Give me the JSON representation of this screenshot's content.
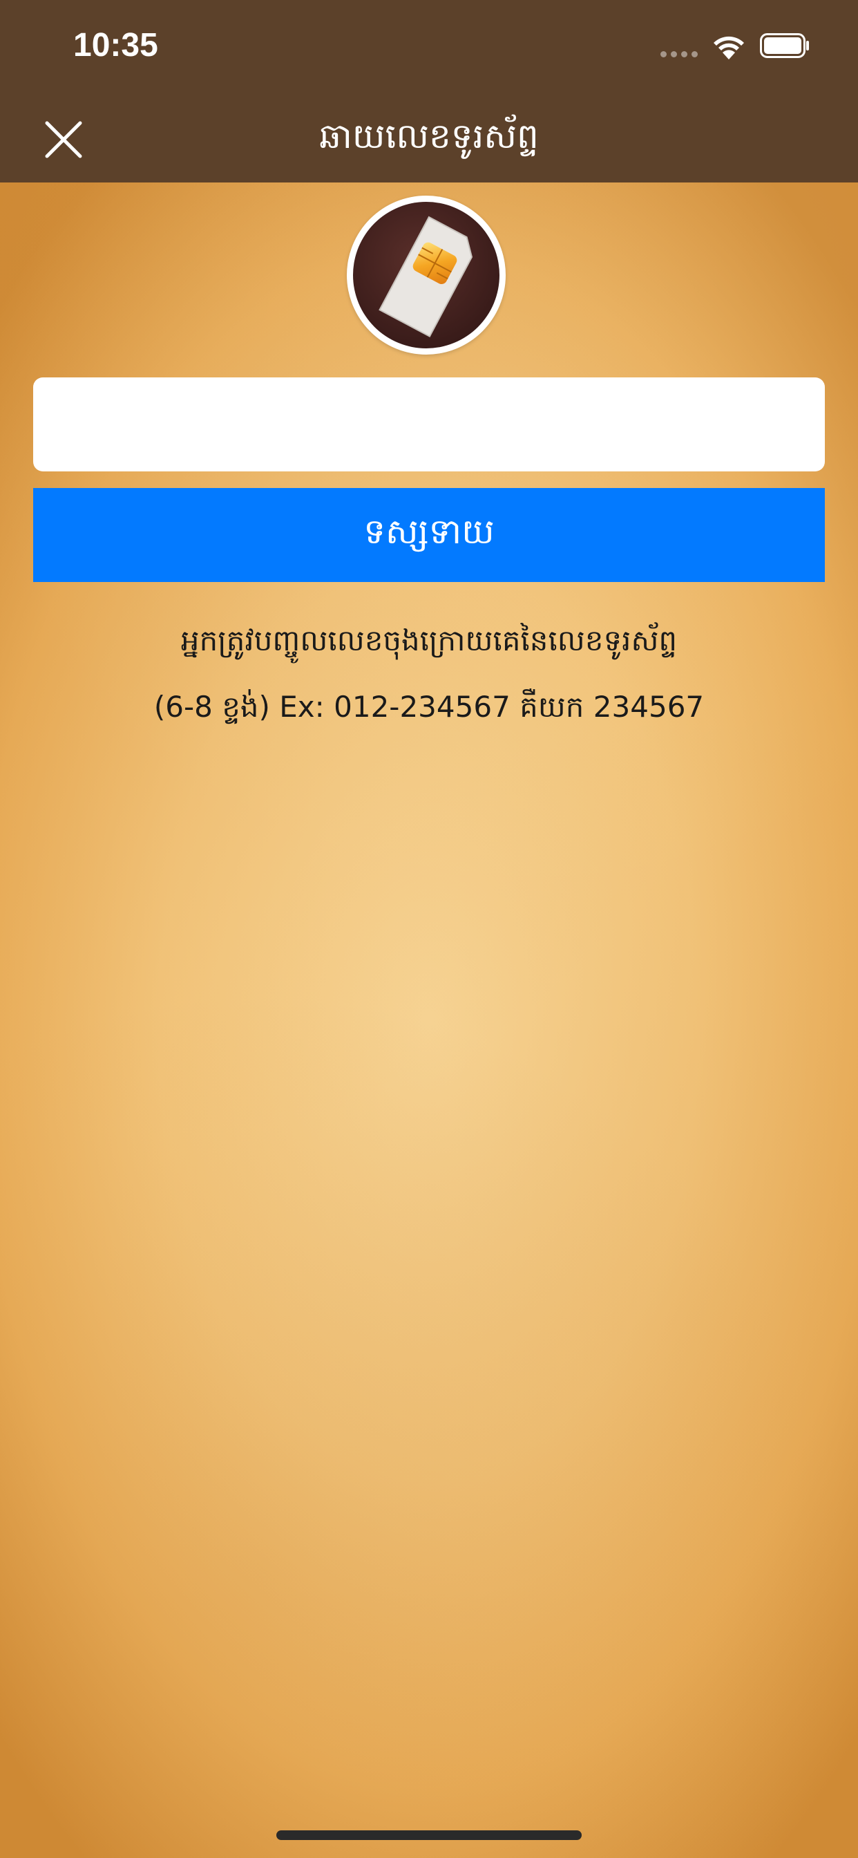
{
  "status_bar": {
    "time": "10:35"
  },
  "nav": {
    "title": "ឆាយលេខទូរស័ព្ទ",
    "close_icon": "close-icon"
  },
  "avatar": {
    "icon": "sim-card-icon"
  },
  "form": {
    "phone_value": "",
    "phone_placeholder": "",
    "predict_label": "ទស្សទាយ"
  },
  "hints": {
    "line1": "អ្នកត្រូវបញ្ចូលលេខចុងក្រោយគេនៃលេខទូរស័ព្ទ",
    "line2": "(6-8 ខ្ទង់) Ex: 012-234567 គឺយក 234567"
  },
  "colors": {
    "header": "#5c412a",
    "button": "#037aff",
    "background": "#f2c47a"
  }
}
